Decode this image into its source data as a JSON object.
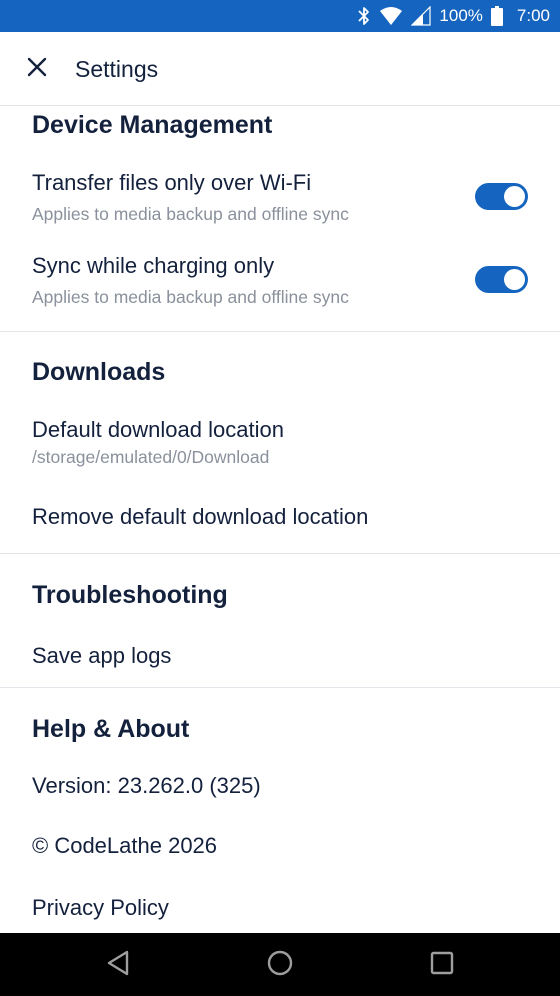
{
  "status_bar": {
    "battery_percent": "100%",
    "time": "7:00",
    "icons": [
      "bluetooth-icon",
      "wifi-icon",
      "signal-icon",
      "battery-icon"
    ],
    "background_color": "#1565c0"
  },
  "app_bar": {
    "title": "Settings",
    "close_icon": "close-icon"
  },
  "sections": {
    "device_management": {
      "header": "Device Management",
      "wifi_only": {
        "title": "Transfer files only over Wi-Fi",
        "subtitle": "Applies to media backup and offline sync",
        "enabled": true
      },
      "charging_only": {
        "title": "Sync while charging only",
        "subtitle": "Applies to media backup and offline sync",
        "enabled": true
      }
    },
    "downloads": {
      "header": "Downloads",
      "default_location_title": "Default download location",
      "default_location_path": "/storage/emulated/0/Download",
      "remove_default_location": "Remove default download location"
    },
    "troubleshooting": {
      "header": "Troubleshooting",
      "save_app_logs": "Save app logs"
    },
    "help_about": {
      "header": "Help & About",
      "version": "Version: 23.262.0 (325)",
      "copyright": "© CodeLathe 2026",
      "privacy_policy": "Privacy Policy"
    }
  },
  "nav_bar": {
    "icons": [
      "back-icon",
      "home-icon",
      "recents-icon"
    ]
  },
  "colors": {
    "accent": "#1565c0",
    "text_primary": "#14213d",
    "text_secondary": "#8a919c",
    "divider": "#e2e5ea"
  }
}
